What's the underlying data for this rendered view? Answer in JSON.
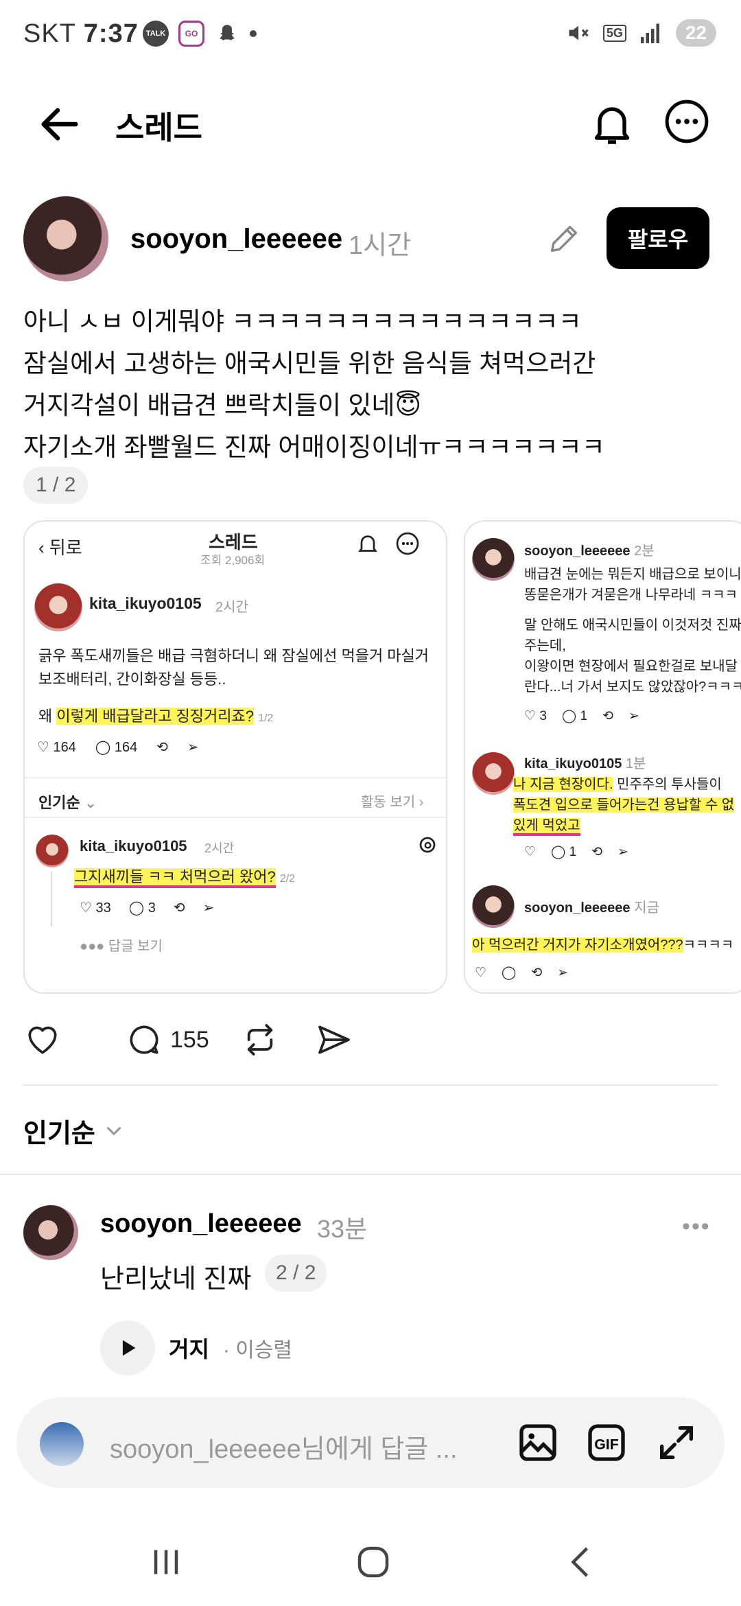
{
  "status_bar": {
    "carrier": "SKT",
    "time": "7:37",
    "battery": "22",
    "network": "5G"
  },
  "header": {
    "title": "스레드"
  },
  "post": {
    "author": "sooyon_leeeeee",
    "time": "1시간",
    "follow_label": "팔로우",
    "lines": [
      "아니 ㅅㅂ 이게뭐야 ㅋㅋㅋㅋㅋㅋㅋㅋㅋㅋㅋㅋㅋㅋㅋ",
      "잠실에서 고생하는 애국시민들 위한 음식들 쳐먹으러간",
      "거지각설이 배급견 쁘락치들이 있네😇",
      "자기소개 좌빨월드 진짜 어매이징이네ㅠㅋㅋㅋㅋㅋㅋㅋ"
    ],
    "page_indicator": "1 / 2",
    "comment_count": "155"
  },
  "image1": {
    "back": "뒤로",
    "title": "스레드",
    "views": "조회 2,906회",
    "user": "kita_ikuyo0105",
    "time": "2시간",
    "text1": "긁우 폭도새끼들은 배급 극혐하더니 왜 잠실에선 먹을거 마실거",
    "text2": "보조배터리, 간이화장실 등등..",
    "text3a": "왜 ",
    "text3b": "이렇게 배급달라고 징징거리죠?",
    "text3c": "1/2",
    "likes": "164",
    "comments": "164",
    "sort": "인기순",
    "activity": "활동 보기",
    "r_user": "kita_ikuyo0105",
    "r_time": "2시간",
    "r_text": "그지새끼들 ㅋㅋ 처먹으러 왔어?",
    "r_page": "2/2",
    "r_likes": "33",
    "r_comments": "3",
    "replies": "답글 보기"
  },
  "image2": {
    "user1": "sooyon_leeeeee",
    "time1": "2분",
    "t1": "배급견 눈에는 뭐든지 배급으로 보이니",
    "t2": "똥묻은개가 겨묻은개 나무라네 ㅋㅋㅋ",
    "t3": "말 안해도 애국시민들이 이것저것 진짜",
    "t4": "주는데,",
    "t5": "이왕이면 현장에서 필요한걸로 보내달",
    "t6": "란다...너 가서 보지도 않았잖아?ㅋㅋㅋ",
    "likes1": "3",
    "comments1": "1",
    "user2": "kita_ikuyo0105",
    "time2": "1분",
    "t7a": "나 지금 현장이다.",
    "t7b": " 민주주의 투사들이 ",
    "t8": "폭도견 입으로 들어가는건 용납할 수 없",
    "t9": "있게 먹었고",
    "comments2": "1",
    "user3": "sooyon_leeeeee",
    "time3": "지금",
    "t10a": "아 먹으러간 거지가 자기소개였어???",
    "t10b": "ㅋㅋㅋㅋ"
  },
  "sort": {
    "label": "인기순"
  },
  "comment": {
    "author": "sooyon_leeeeee",
    "time": "33분",
    "text": "난리났네 진짜",
    "page_indicator": "2 / 2",
    "song": "거지",
    "artist": "· 이승렬"
  },
  "reply": {
    "placeholder": "sooyon_leeeeee님에게 답글 ..."
  },
  "colors": {
    "highlight": "#fff35a",
    "underline": "#e0338a",
    "follow_bg": "#000000"
  }
}
